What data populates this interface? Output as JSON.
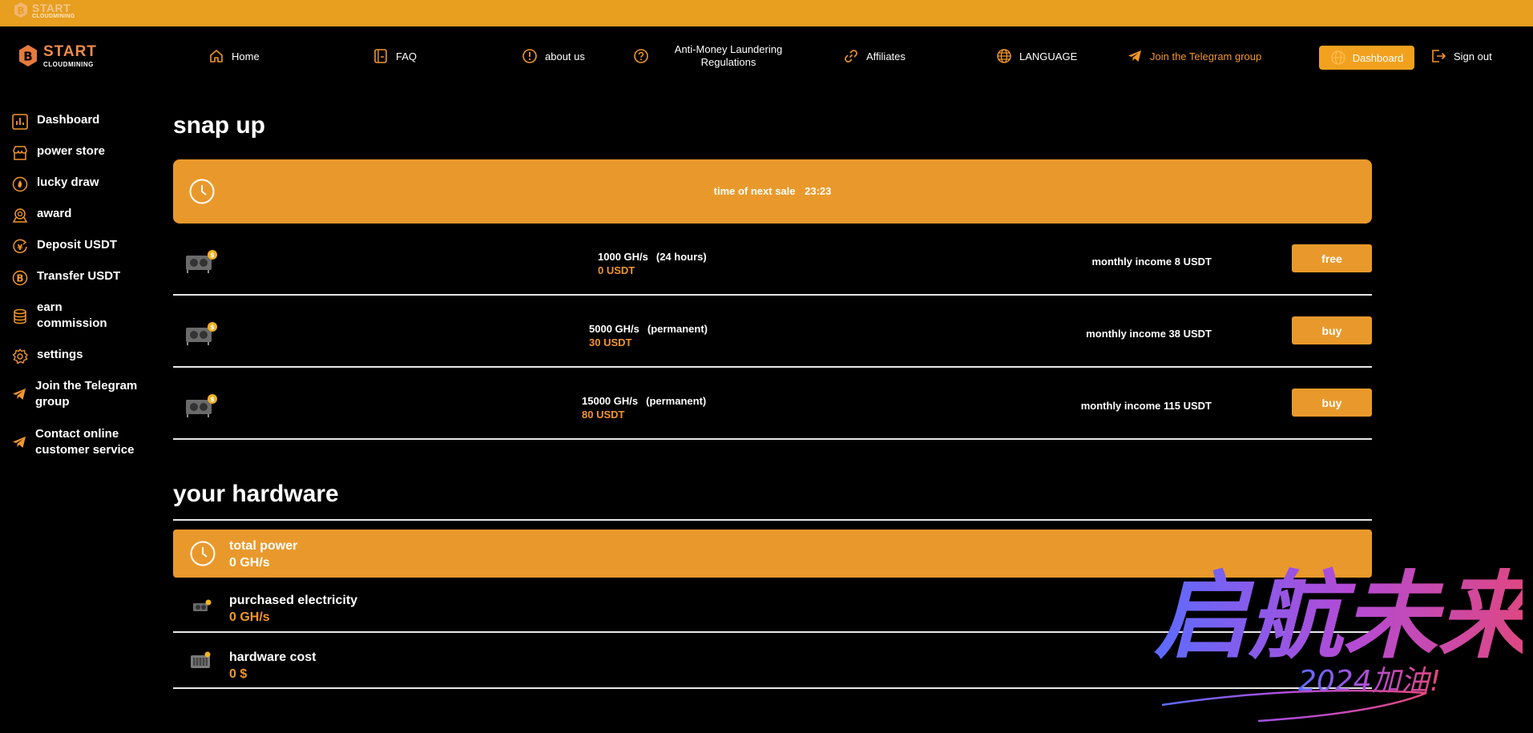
{
  "topstrip": {
    "brand_top": "START",
    "brand_bottom": "CLOUDMINING"
  },
  "header": {
    "brand_top": "START",
    "brand_bottom": "CLOUDMINING",
    "nav": {
      "home": "Home",
      "faq": "FAQ",
      "about": "about us",
      "aml": "Anti-Money Laundering Regulations",
      "affiliates": "Affiliates",
      "language": "LANGUAGE",
      "telegram": "Join the Telegram group",
      "dashboard": "Dashboard",
      "signout": "Sign out"
    }
  },
  "sidebar": {
    "items": [
      {
        "label": "Dashboard"
      },
      {
        "label": "power store"
      },
      {
        "label": "lucky draw"
      },
      {
        "label": "award"
      },
      {
        "label": "Deposit USDT"
      },
      {
        "label": "Transfer USDT"
      },
      {
        "label": "earn commission"
      },
      {
        "label": "settings"
      },
      {
        "label": "Join the Telegram group"
      },
      {
        "label": "Contact online customer service"
      }
    ]
  },
  "snap": {
    "title": "snap up",
    "next_sale_label": "time of next sale",
    "next_sale_time": "23:23"
  },
  "products": [
    {
      "spec": "1000 GH/s",
      "duration": "(24 hours)",
      "price": "0 USDT",
      "income": "monthly income 8 USDT",
      "button": "free"
    },
    {
      "spec": "5000 GH/s",
      "duration": "(permanent)",
      "price": "30 USDT",
      "income": "monthly income 38 USDT",
      "button": "buy"
    },
    {
      "spec": "15000 GH/s",
      "duration": "(permanent)",
      "price": "80 USDT",
      "income": "monthly income 115 USDT",
      "button": "buy"
    }
  ],
  "hardware": {
    "title": "your hardware",
    "total_power": {
      "label": "total power",
      "value": "0 GH/s"
    },
    "purchased": {
      "label": "purchased electricity",
      "value": "0 GH/s"
    },
    "cost": {
      "label": "hardware cost",
      "value": "0 $"
    }
  },
  "watermark": {
    "text": "启航未来",
    "sub": "2024加油!"
  },
  "colors": {
    "accent": "#e9992b",
    "accent_text": "#f2962a",
    "background": "#000000"
  }
}
